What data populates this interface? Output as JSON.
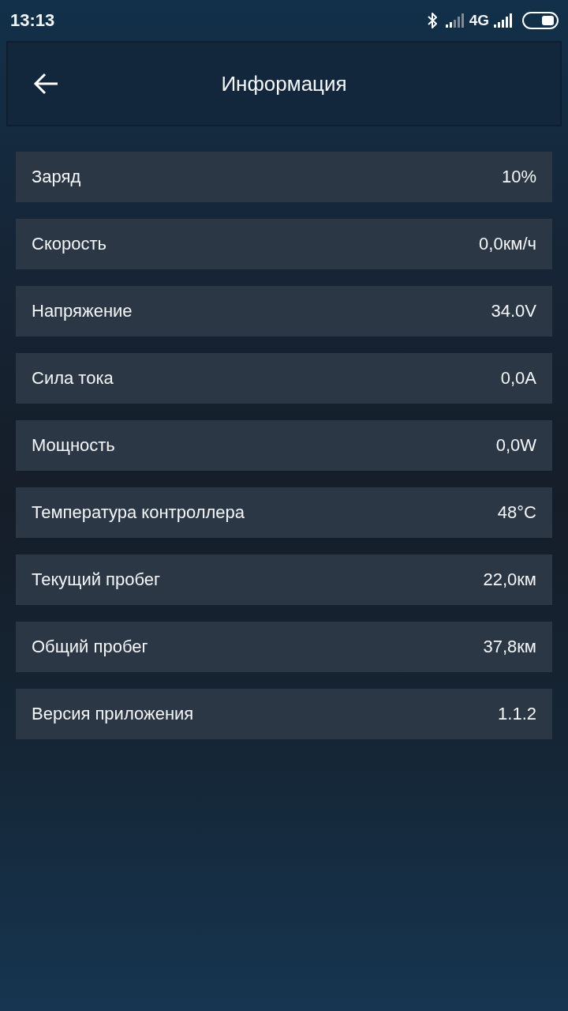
{
  "status_bar": {
    "time": "13:13",
    "network": "4G"
  },
  "header": {
    "title": "Информация"
  },
  "rows": [
    {
      "label": "Заряд",
      "value": "10%"
    },
    {
      "label": "Скорость",
      "value": "0,0км/ч"
    },
    {
      "label": "Напряжение",
      "value": "34.0V"
    },
    {
      "label": "Сила тока",
      "value": "0,0A"
    },
    {
      "label": "Мощность",
      "value": "0,0W"
    },
    {
      "label": "Температура контроллера",
      "value": "48°C"
    },
    {
      "label": "Текущий пробег",
      "value": "22,0км"
    },
    {
      "label": "Общий пробег",
      "value": "37,8км"
    },
    {
      "label": "Версия приложения",
      "value": "1.1.2"
    }
  ]
}
